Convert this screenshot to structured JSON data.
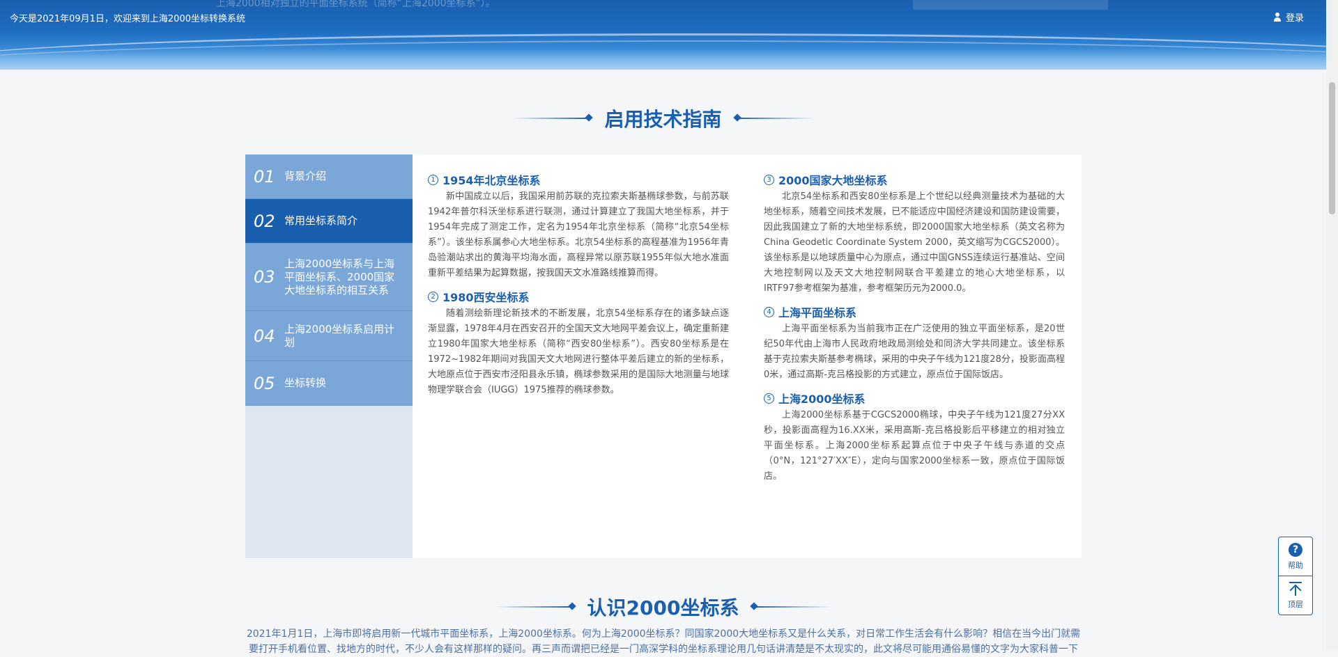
{
  "header": {
    "ghost_text": "上海2000相对独立的平面坐标系统（简称“上海2000坐标系”）。",
    "welcome": "今天是2021年09月1日，欢迎来到上海2000坐标转换系统",
    "login_label": "登录"
  },
  "section1": {
    "title": "启用技术指南"
  },
  "sidenav": {
    "items": [
      {
        "num": "01",
        "label": "背景介绍"
      },
      {
        "num": "02",
        "label": "常用坐标系简介"
      },
      {
        "num": "03",
        "label": "上海2000坐标系与上海平面坐标系、2000国家大地坐标系的相互关系"
      },
      {
        "num": "04",
        "label": "上海2000坐标系启用计划"
      },
      {
        "num": "05",
        "label": "坐标转换"
      }
    ]
  },
  "articles": {
    "a1": {
      "marker": "1",
      "title": "1954年北京坐标系",
      "body": "新中国成立以后，我国采用前苏联的克拉索夫斯基椭球参数，与前苏联1942年普尔科沃坐标系进行联测，通过计算建立了我国大地坐标系，并于1954年完成了测定工作，定名为1954年北京坐标系（简称“北京54坐标系”）。该坐标系属参心大地坐标系。北京54坐标系的高程基准为1956年青岛验潮站求出的黄海平均海水面，高程异常以原苏联1955年似大地水准面重新平差结果为起算数据，按我国天文水准路线推算而得。"
    },
    "a2": {
      "marker": "2",
      "title": "1980西安坐标系",
      "body": "随着测绘新理论新技术的不断发展，北京54坐标系存在的诸多缺点逐渐显露，1978年4月在西安召开的全国天文大地网平差会议上，确定重新建立1980年国家大地坐标系（简称“西安80坐标系”）。西安80坐标系是在1972~1982年期间对我国天文大地网进行整体平差后建立的新的坐标系，大地原点位于西安市泾阳县永乐镇，椭球参数采用的是国际大地测量与地球物理学联合会（IUGG）1975推荐的椭球参数。"
    },
    "a3": {
      "marker": "3",
      "title": "2000国家大地坐标系",
      "body": "北京54坐标系和西安80坐标系是上个世纪以经典测量技术为基础的大地坐标系，随着空间技术发展，已不能适应中国经济建设和国防建设需要，因此我国建立了新的大地坐标系统，即2000国家大地坐标系（英文名称为China Geodetic Coordinate System 2000，英文缩写为CGCS2000）。该坐标系是以地球质量中心为原点，通过中国GNSS连续运行基准站、空间大地控制网以及天文大地控制网联合平差建立的地心大地坐标系，以IRTF97参考框架为基准，参考框架历元为2000.0。"
    },
    "a4": {
      "marker": "4",
      "title": "上海平面坐标系",
      "body": "上海平面坐标系为当前我市正在广泛使用的独立平面坐标系，是20世纪50年代由上海市人民政府地政局测绘处和同济大学共同建立。该坐标系基于克拉索夫斯基参考椭球，采用的中央子午线为121度28分，投影面高程0米，通过高斯-克吕格投影的方式建立，原点位于国际饭店。"
    },
    "a5": {
      "marker": "5",
      "title": "上海2000坐标系",
      "body": "上海2000坐标系基于CGCS2000椭球，中央子午线为121度27分XX秒，投影面高程为16.XX米，采用高斯-克吕格投影后平移建立的相对独立平面坐标系。上海2000坐标系起算点位于中央子午线与赤道的交点（0°N，121°27′XX″E），定向与国家2000坐标系一致，原点位于国际饭店。"
    }
  },
  "section2": {
    "title": "认识2000坐标系",
    "intro": "2021年1月1日，上海市即将启用新一代城市平面坐标系，上海2000坐标系。何为上海2000坐标系？同国家2000大地坐标系又是什么关系，对日常工作生活会有什么影响？相信在当今出门就需要打开手机看位置、找地方的时代，不少人会有这样那样的疑问。再三声而谓把已经是一门高深学科的坐标系理论用几句话讲清楚是不太现实的，此文将尽可能用通俗易懂的文字为大家科普一下"
  },
  "float": {
    "help_label": "帮助",
    "top_label": "顶层"
  }
}
